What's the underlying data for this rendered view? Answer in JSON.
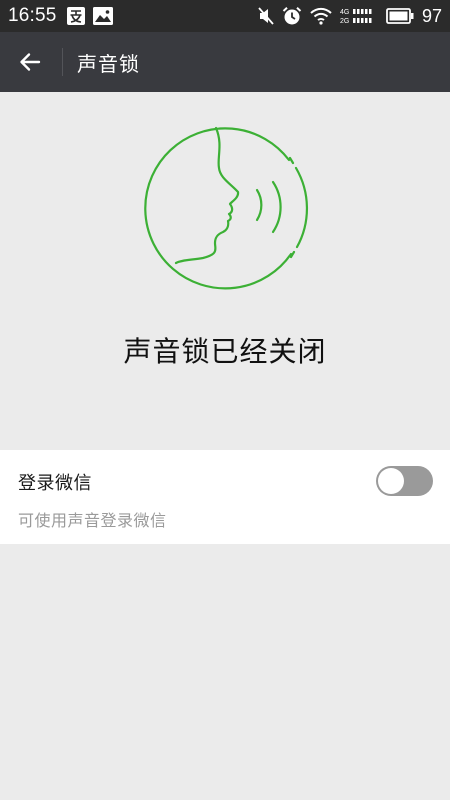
{
  "status_bar": {
    "time": "16:55",
    "battery": "97",
    "network_labels": [
      "4G",
      "2G"
    ],
    "left_icons": [
      "alipay-icon",
      "image-icon"
    ],
    "right_icons": [
      "mute-icon",
      "alarm-icon",
      "wifi-icon",
      "signal-icon",
      "battery-icon"
    ]
  },
  "app_bar": {
    "title": "声音锁",
    "back_icon": "arrow-left-icon"
  },
  "hero": {
    "status_text": "声音锁已经关闭",
    "illustration_icon": "voice-face-icon"
  },
  "setting": {
    "title": "登录微信",
    "description": "可使用声音登录微信",
    "toggle_on": false
  },
  "colors": {
    "status_bar": "#2b2b2b",
    "app_bar": "#393a3f",
    "background": "#ebebeb",
    "accent_green": "#3cb035",
    "toggle_off": "#9a9a9a"
  }
}
